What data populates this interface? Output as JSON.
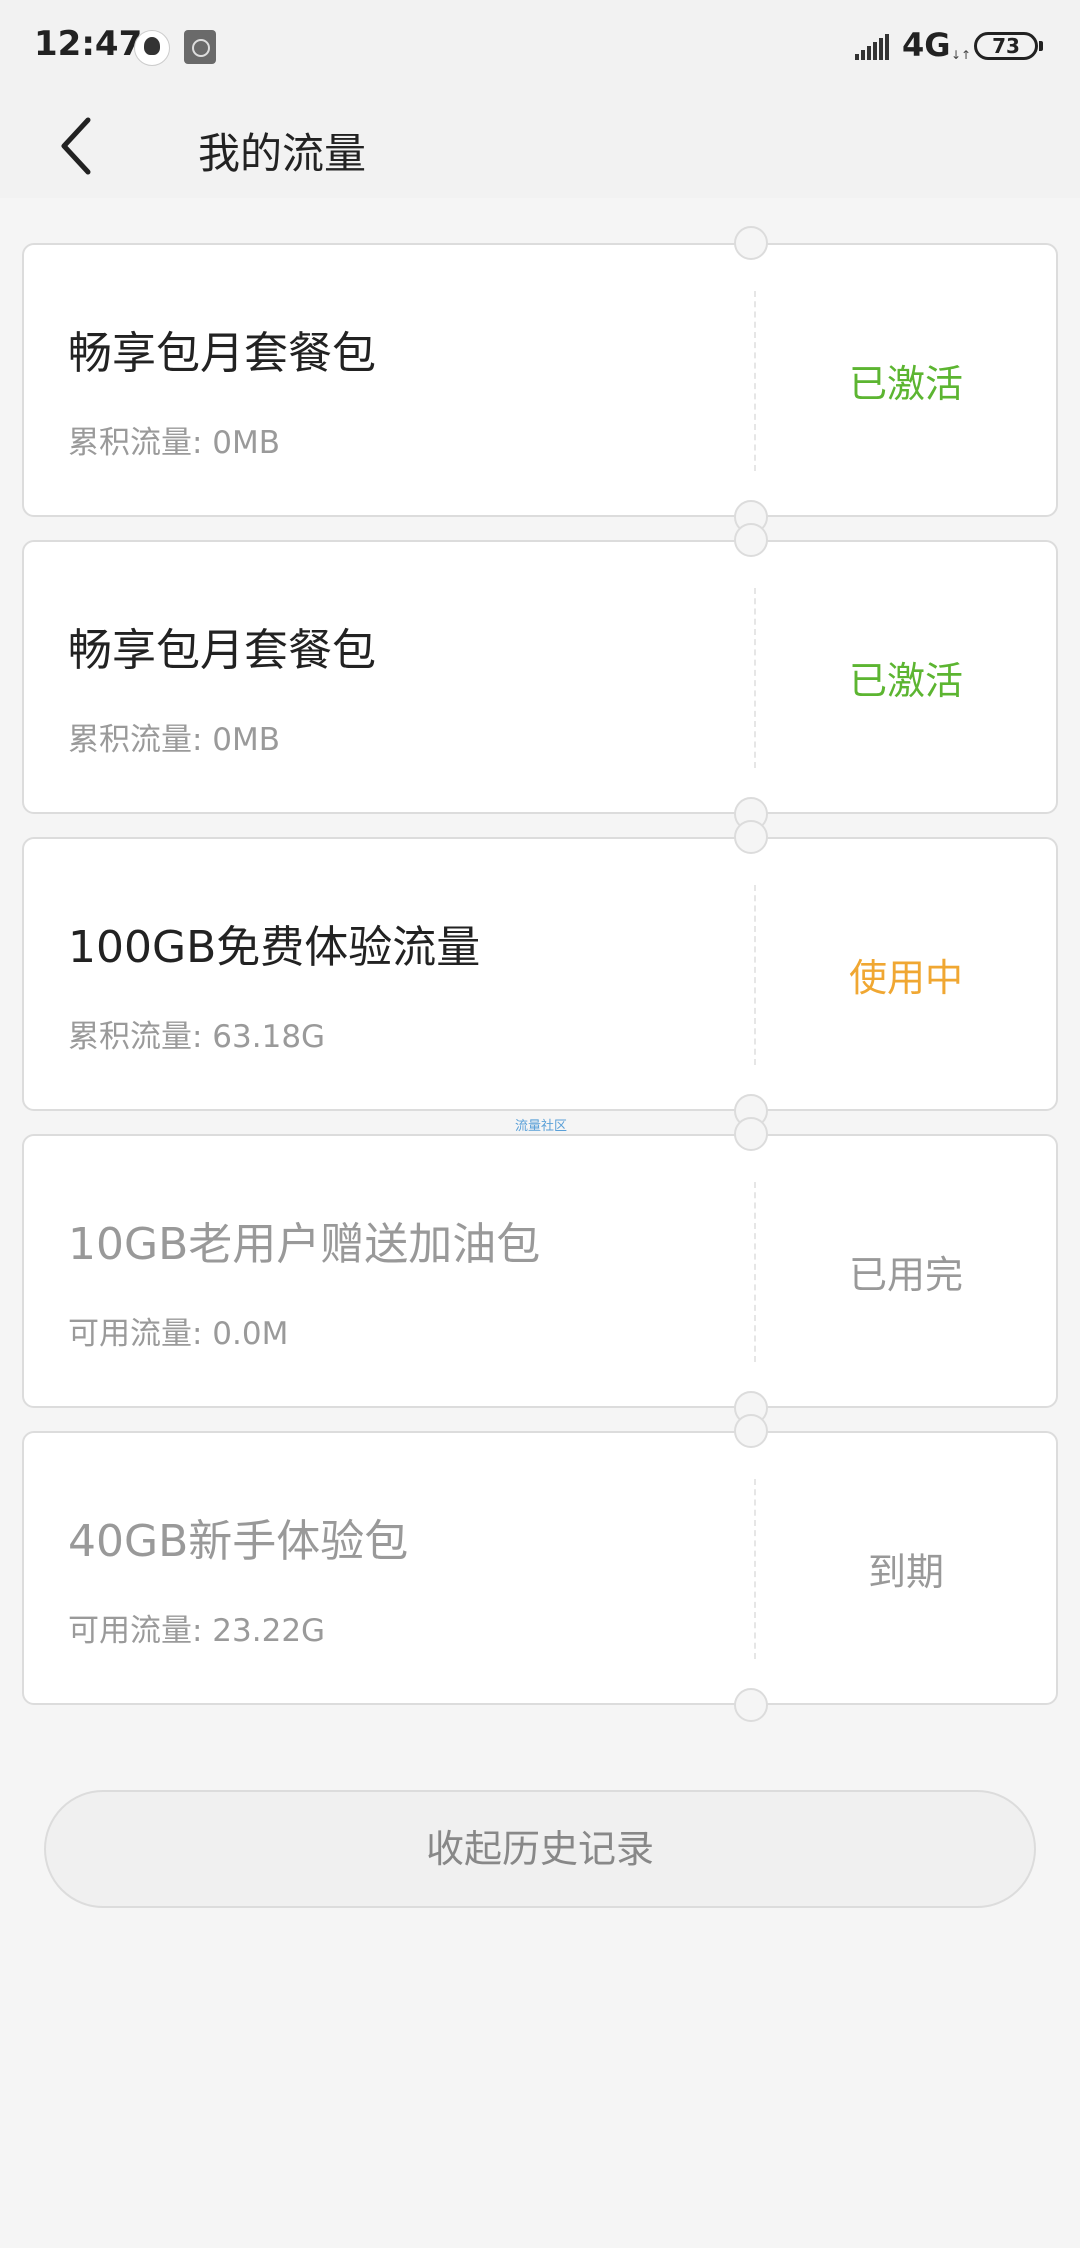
{
  "status_bar": {
    "time": "12:47",
    "network": "4G",
    "net_arrows": "↓↑",
    "battery": "73",
    "icons": [
      "avatar-app-icon",
      "notes-app-icon",
      "signal-icon",
      "battery-icon"
    ]
  },
  "header": {
    "title": "我的流量",
    "back_icon": "chevron-left-icon"
  },
  "cards": [
    {
      "title": "畅享包月套餐包",
      "usage": "累积流量: 0MB",
      "status": "已激活",
      "status_color": "#5cb531",
      "muted": false
    },
    {
      "title": "畅享包月套餐包",
      "usage": "累积流量: 0MB",
      "status": "已激活",
      "status_color": "#5cb531",
      "muted": false
    },
    {
      "title": "100GB免费体验流量",
      "usage": "累积流量: 63.18G",
      "status": "使用中",
      "status_color": "#f0a732",
      "muted": false
    },
    {
      "title": "10GB老用户赠送加油包",
      "usage": "可用流量: 0.0M",
      "status": "已用完",
      "status_color": "#999999",
      "muted": true
    },
    {
      "title": "40GB新手体验包",
      "usage": "可用流量: 23.22G",
      "status": "到期",
      "status_color": "#999999",
      "muted": true
    }
  ],
  "watermark": "流量社区",
  "collapse_button": {
    "label": "收起历史记录"
  }
}
